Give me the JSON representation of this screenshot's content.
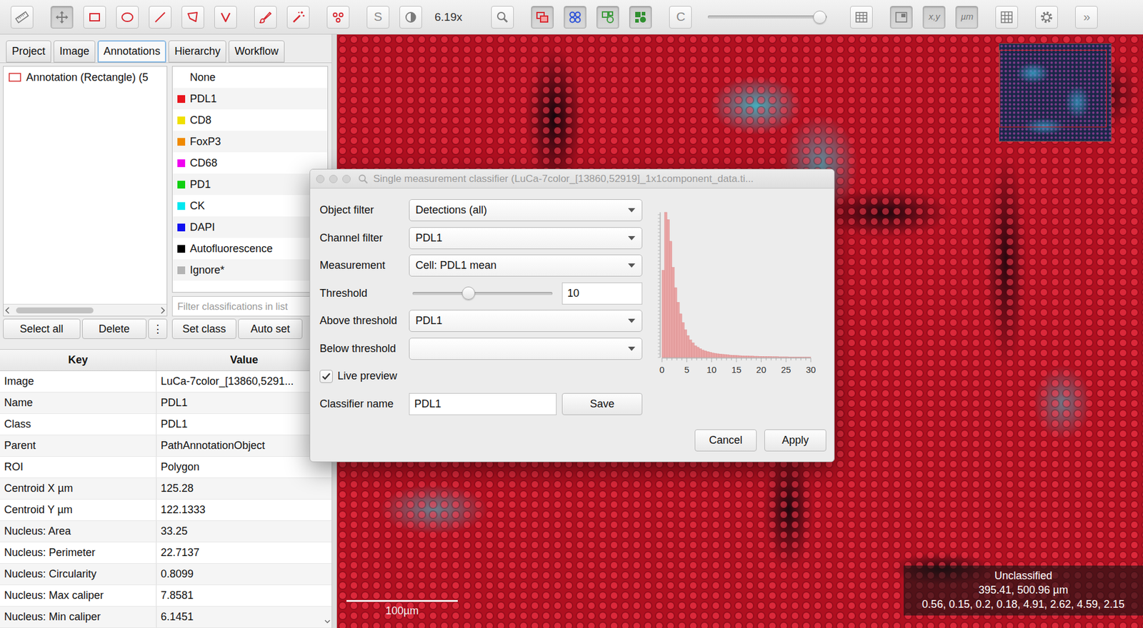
{
  "toolbar": {
    "tools": [
      {
        "kind": "icon",
        "selected": false
      },
      {
        "kind": "icon",
        "selected": true
      },
      {
        "kind": "icon",
        "selected": false
      },
      {
        "kind": "icon",
        "selected": false
      },
      {
        "kind": "icon",
        "selected": false
      },
      {
        "kind": "icon",
        "selected": false
      },
      {
        "kind": "icon",
        "selected": false
      },
      {
        "kind": "icon",
        "selected": false
      },
      {
        "kind": "icon",
        "selected": false
      },
      {
        "kind": "icon",
        "selected": false
      },
      {
        "kind": "text",
        "label": "S",
        "selected": false
      },
      {
        "kind": "icon",
        "selected": false
      }
    ],
    "zoom": "6.19x",
    "view_buttons": [
      {
        "kind": "icon",
        "selected": false
      },
      {
        "kind": "icon",
        "selected": true
      },
      {
        "kind": "icon",
        "selected": true
      },
      {
        "kind": "icon",
        "selected": true
      },
      {
        "kind": "icon",
        "selected": true
      },
      {
        "kind": "text",
        "label": "C",
        "selected": false
      }
    ],
    "opacity": {
      "level": 0.94
    },
    "panel_buttons": [
      {
        "kind": "icon",
        "selected": false
      },
      {
        "kind": "icon",
        "selected": true
      },
      {
        "kind": "text",
        "label": "x,y",
        "selected": true
      },
      {
        "kind": "text",
        "label": "µm",
        "selected": true
      },
      {
        "kind": "icon",
        "selected": false
      },
      {
        "kind": "icon",
        "selected": false
      },
      {
        "kind": "text",
        "label": "»",
        "selected": false
      }
    ]
  },
  "left_panel": {
    "tabs": [
      {
        "label": "Project",
        "selected": false
      },
      {
        "label": "Image",
        "selected": false
      },
      {
        "label": "Annotations",
        "selected": true
      },
      {
        "label": "Hierarchy",
        "selected": false
      },
      {
        "label": "Workflow",
        "selected": false
      }
    ],
    "annotations": [
      {
        "label": "Annotation (Rectangle) (5",
        "color": "#d42a2a",
        "selected": false
      }
    ],
    "annotation_buttons": [
      "Select all",
      "Delete",
      "⋮"
    ],
    "classes": [
      {
        "name": "None",
        "selected": false
      },
      {
        "name": "PDL1",
        "color": "#e8141c",
        "selected": false
      },
      {
        "name": "CD8",
        "color": "#f0e000",
        "selected": false
      },
      {
        "name": "FoxP3",
        "color": "#f08a00",
        "selected": false
      },
      {
        "name": "CD68",
        "color": "#f000f0",
        "selected": false
      },
      {
        "name": "PD1",
        "color": "#10d010",
        "selected": false
      },
      {
        "name": "CK",
        "color": "#00e8f0",
        "selected": false
      },
      {
        "name": "DAPI",
        "color": "#1010f0",
        "selected": false
      },
      {
        "name": "Autofluorescence",
        "color": "#000000",
        "selected": false
      },
      {
        "name": "Ignore*",
        "color": "#b4b4b4",
        "selected": false
      }
    ],
    "class_filter": {
      "placeholder": "Filter classifications in list"
    },
    "class_buttons": [
      "Set class",
      "Auto set"
    ]
  },
  "table": {
    "columns": [
      "Key",
      "Value"
    ],
    "rows": [
      [
        "Image",
        "LuCa-7color_[13860,5291..."
      ],
      [
        "Name",
        "PDL1"
      ],
      [
        "Class",
        "PDL1"
      ],
      [
        "Parent",
        "PathAnnotationObject"
      ],
      [
        "ROI",
        "Polygon"
      ],
      [
        "Centroid X µm",
        "125.28"
      ],
      [
        "Centroid Y µm",
        "122.1333"
      ],
      [
        "Nucleus: Area",
        "33.25"
      ],
      [
        "Nucleus: Perimeter",
        "22.7137"
      ],
      [
        "Nucleus: Circularity",
        "0.8099"
      ],
      [
        "Nucleus: Max caliper",
        "7.8581"
      ],
      [
        "Nucleus: Min caliper",
        "6.1451"
      ]
    ]
  },
  "viewer": {
    "scale_bar": "100µm",
    "info": [
      "Unclassified",
      "395.41, 500.96 µm",
      "0.56, 0.15, 0.2, 0.18, 4.91, 2.62, 4.59, 2.15"
    ]
  },
  "dialog": {
    "title": "Single measurement classifier (LuCa-7color_[13860,52919]_1x1component_data.ti...",
    "fields": [
      {
        "kind": "select",
        "label": "Object filter",
        "value": "Detections (all)"
      },
      {
        "kind": "select",
        "label": "Channel filter",
        "value": "PDL1"
      },
      {
        "kind": "select",
        "label": "Measurement",
        "value": "Cell: PDL1 mean"
      },
      {
        "kind": "slider",
        "label": "Threshold",
        "level": 0.4,
        "value": "10"
      },
      {
        "kind": "select",
        "label": "Above threshold",
        "value": "PDL1"
      },
      {
        "kind": "select",
        "label": "Below threshold",
        "value": ""
      },
      {
        "kind": "checkbox",
        "label": "Live preview",
        "checked": true
      },
      {
        "kind": "name",
        "label": "Classifier name",
        "value": "PDL1",
        "button": "Save"
      }
    ],
    "histogram": {
      "values": [
        60,
        100,
        95,
        80,
        62,
        48,
        38,
        30,
        24,
        19,
        15,
        12,
        10,
        8,
        7,
        6,
        5,
        4.5,
        4,
        3.5,
        3,
        2.8,
        2.5,
        2.3,
        2.1,
        2,
        1.8,
        1.6,
        1.5,
        1.4,
        1.3,
        1.2,
        1.1,
        1,
        1,
        0.9,
        0.9,
        0.8,
        0.8,
        0.7,
        0.7,
        0.6,
        0.6,
        0.6,
        0.5,
        0.5,
        0.5,
        0.4,
        0.4,
        0.4,
        0.4,
        0.3,
        0.3,
        0.3,
        0.3,
        0.3,
        0.2,
        0.2,
        0.2,
        0.2
      ],
      "ticks": [
        "0",
        "5",
        "10",
        "15",
        "20",
        "25",
        "30"
      ]
    },
    "buttons": [
      "Cancel",
      "Apply"
    ]
  }
}
